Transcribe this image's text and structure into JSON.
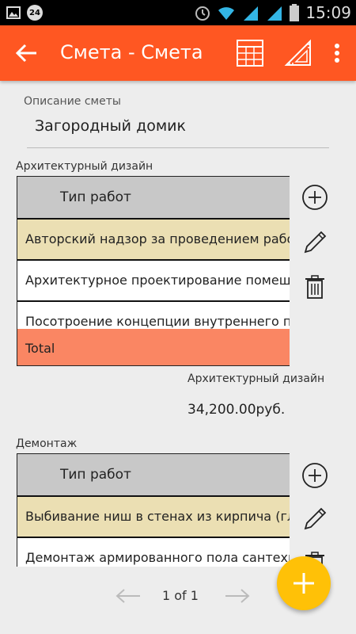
{
  "status": {
    "notif_badge": "24",
    "time": "15:09"
  },
  "appbar": {
    "title": "Смета - Смета"
  },
  "description": {
    "label": "Описание сметы",
    "value": "Загородный домик"
  },
  "sections": [
    {
      "label": "Архитектурный дизайн",
      "header": "Тип работ",
      "rows": [
        "Авторский надзор за проведением работ",
        "Архитектурное проектирование помещений",
        "Посотроение концепции внутреннего пространства"
      ],
      "total_label": "Total",
      "summary_label": "Архитектурный дизайн",
      "summary_value": "34,200.00руб."
    },
    {
      "label": "Демонтаж",
      "header": "Тип работ",
      "rows": [
        "Выбивание ниш в стенах из кирпича (глубиной",
        "Демонтаж армированного пола сантехкабины"
      ]
    }
  ],
  "pager": {
    "info": "1 of 1"
  },
  "colors": {
    "appbar": "#ff5722",
    "row_highlight": "#ebdfb3",
    "total_row": "#fa8663",
    "fab": "#ffc107"
  }
}
